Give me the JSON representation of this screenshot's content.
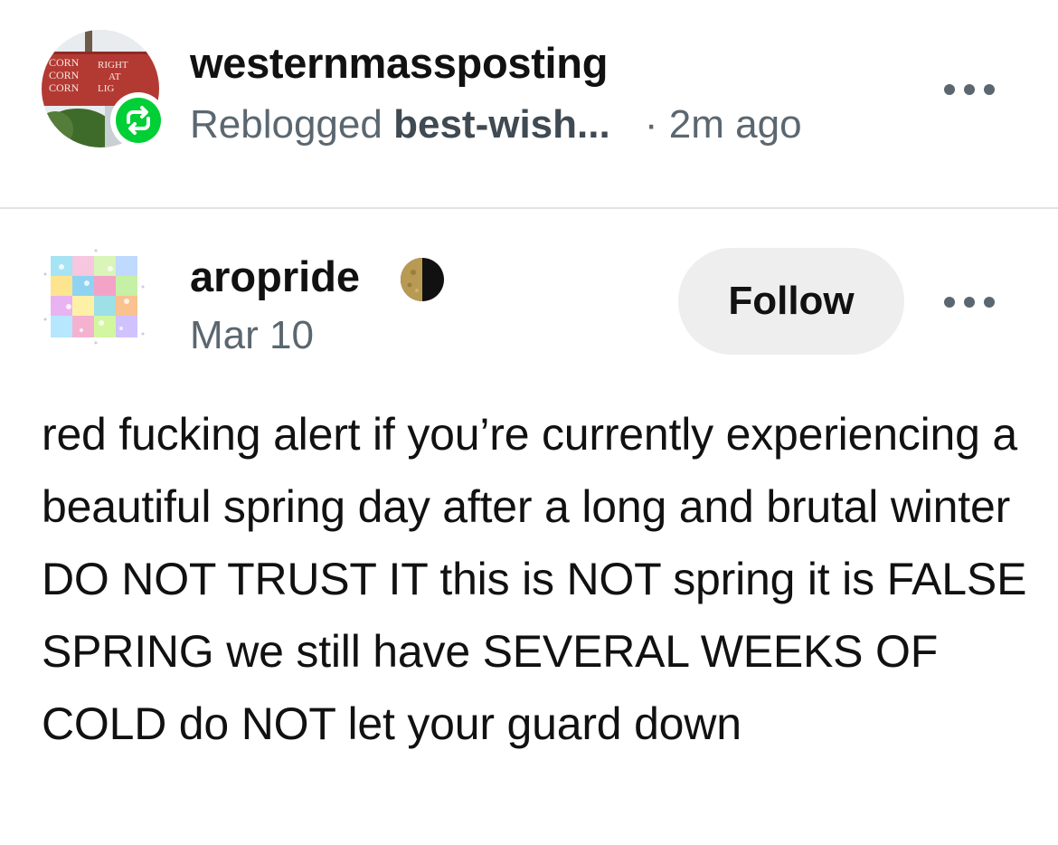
{
  "reblog": {
    "blog_name": "westernmassposting",
    "reblogged_label": "Reblogged",
    "source_blog": "best-wish...",
    "time_ago": "· 2m ago",
    "avatar_sign_text": [
      "CORN RIGHT",
      "CORN AT",
      "CORN LIGHT"
    ],
    "reblog_icon": "reblog-arrows-icon",
    "more_icon": "more-horizontal-icon"
  },
  "post": {
    "author": "aropride",
    "author_badge_icon": "moon-icon",
    "date": "Mar 10",
    "follow_label": "Follow",
    "more_icon": "more-horizontal-icon",
    "body": "red fucking alert if you’re currently experiencing a beautiful spring day after a long and brutal winter DO NOT TRUST IT this is NOT spring it is FALSE SPRING we still have SEVERAL WEEKS OF COLD do NOT let your guard down"
  },
  "colors": {
    "reblog_green": "#00cf35",
    "secondary_text": "#5b6770",
    "follow_bg": "#eeeeef",
    "divider": "#e3e3e3"
  }
}
